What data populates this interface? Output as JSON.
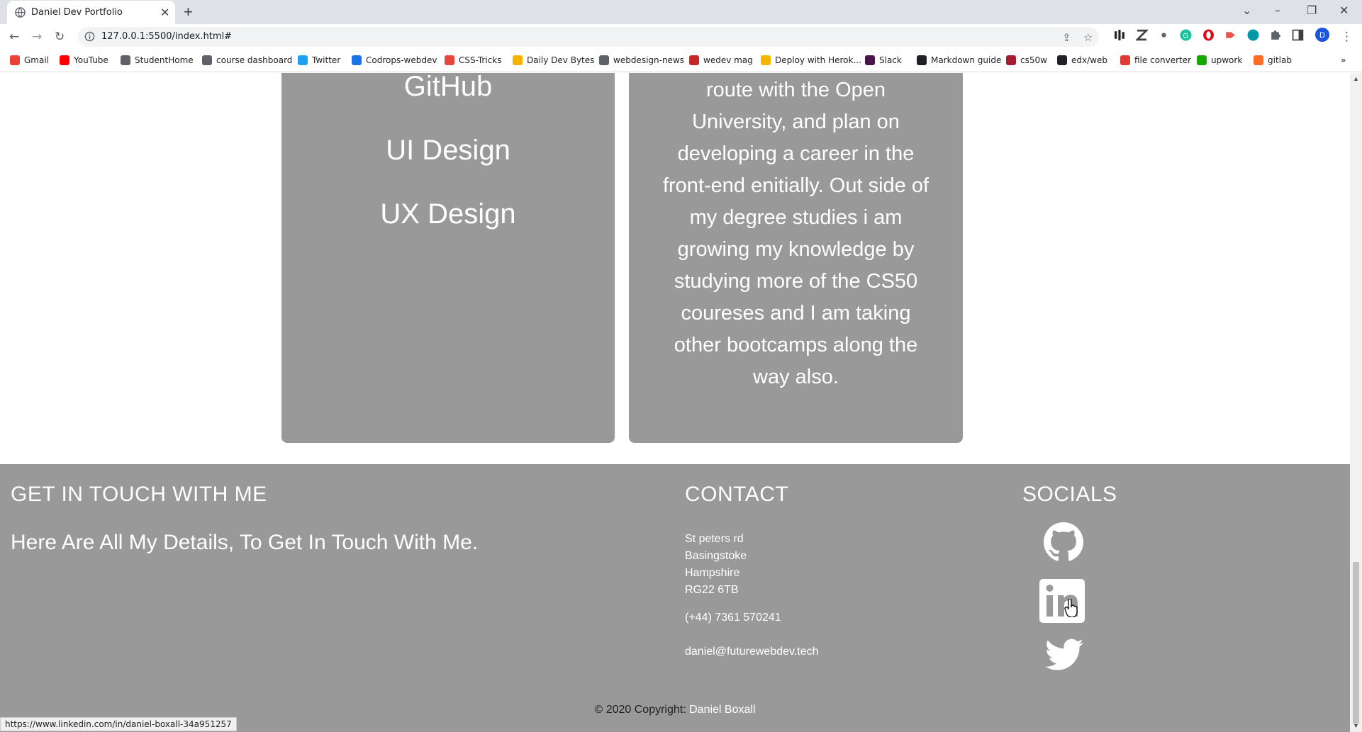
{
  "browser": {
    "tab_title": "Daniel Dev Portfolio",
    "url": "127.0.0.1:5500/index.html#",
    "profile_initial": "D",
    "bookmarks": [
      {
        "label": "Gmail",
        "color": "#ea4335"
      },
      {
        "label": "YouTube",
        "color": "#ff0000"
      },
      {
        "label": "StudentHome",
        "color": "#5f6368"
      },
      {
        "label": "course dashboard",
        "color": "#5f6368"
      },
      {
        "label": "Twitter",
        "color": "#1da1f2"
      },
      {
        "label": "Codrops-webdev",
        "color": "#1a73e8"
      },
      {
        "label": "CSS-Tricks",
        "color": "#e8453c"
      },
      {
        "label": "Daily Dev Bytes",
        "color": "#f4b400"
      },
      {
        "label": "webdesign-news",
        "color": "#5f6368"
      },
      {
        "label": "wedev mag",
        "color": "#c62828"
      },
      {
        "label": "Deploy with Herok...",
        "color": "#f4b400"
      },
      {
        "label": "Slack",
        "color": "#4a154b"
      },
      {
        "label": "Markdown guide",
        "color": "#202124"
      },
      {
        "label": "cs50w",
        "color": "#a51c30"
      },
      {
        "label": "edx/web",
        "color": "#202124"
      },
      {
        "label": "file converter",
        "color": "#e53935"
      },
      {
        "label": "upwork",
        "color": "#14a800"
      },
      {
        "label": "gitlab",
        "color": "#fc6d26"
      }
    ]
  },
  "skills": [
    "GitHub",
    "UI Design",
    "UX Design"
  ],
  "about_lines": [
    "route with the Open",
    "University, and plan on",
    "developing a career in the",
    "front-end enitially. Out side of",
    "my degree studies i am",
    "growing my knowledge by",
    "studying more of the CS50",
    "coureses and I am taking",
    "other bootcamps along the",
    "way also."
  ],
  "footer": {
    "heading_touch": "GET IN TOUCH WITH ME",
    "subheading": "Here Are All My Details, To Get In Touch With Me.",
    "heading_contact": "CONTACT",
    "heading_socials": "SOCIALS",
    "address": [
      "St peters rd",
      "Basingstoke",
      "Hampshire",
      "RG22 6TB"
    ],
    "phone": "(+44) 7361 570241",
    "email": "daniel@futurewebdev.tech",
    "socials": [
      "github-icon",
      "linkedin-icon",
      "twitter-icon"
    ],
    "copyright_prefix": "© 2020 Copyright:",
    "copyright_name": "Daniel Boxall"
  },
  "status_url": "https://www.linkedin.com/in/daniel-boxall-34a951257",
  "colors": {
    "card_bg": "#999999",
    "footer_bg": "#999999"
  }
}
